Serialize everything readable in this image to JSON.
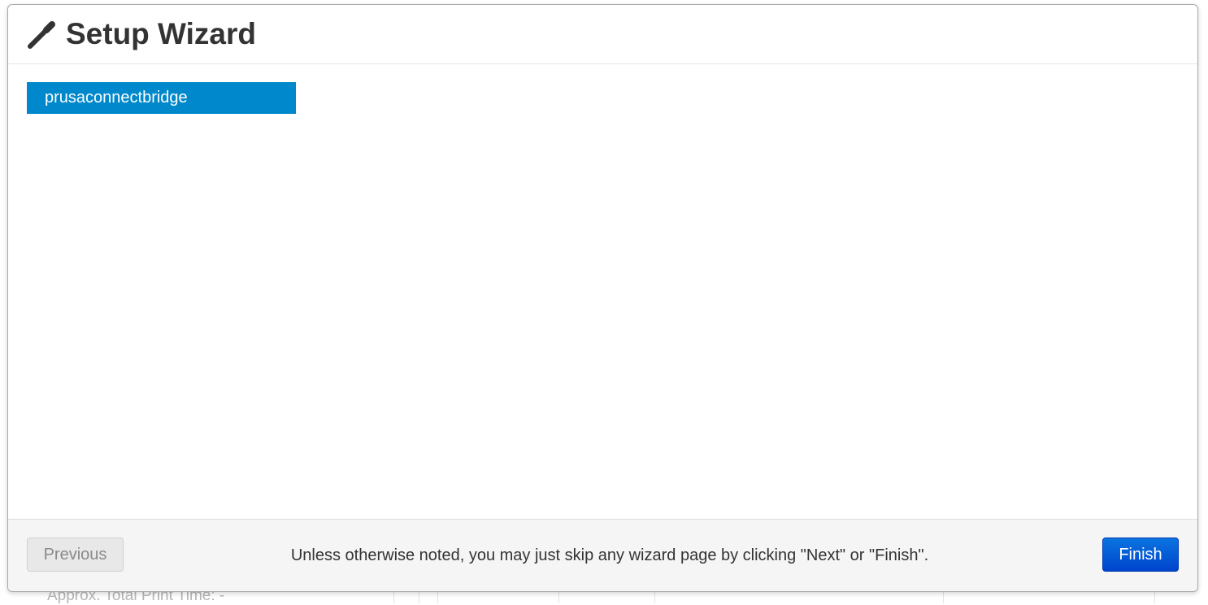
{
  "background": {
    "partial_text": "Approx. Total Print Time: -"
  },
  "modal": {
    "title": "Setup Wizard",
    "title_icon": "magic-wand-icon",
    "nav": {
      "items": [
        {
          "label": "prusaconnectbridge",
          "active": true
        }
      ]
    },
    "footer": {
      "previous_label": "Previous",
      "note": "Unless otherwise noted, you may just skip any wizard page by clicking \"Next\" or \"Finish\".",
      "finish_label": "Finish"
    }
  },
  "colors": {
    "nav_active": "#0088cc",
    "finish_button": "#0055cc",
    "footer_bg": "#f5f5f5"
  }
}
